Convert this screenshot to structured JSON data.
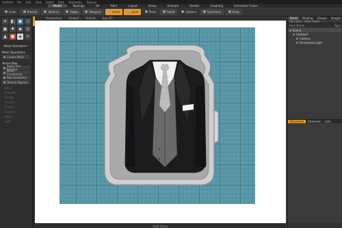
{
  "title_bar": {
    "app": "Untitled",
    "menus": [
      "File",
      "Edit",
      "View",
      "Select",
      "Item",
      "Geometry",
      "Texture"
    ]
  },
  "layout_tabs": [
    {
      "label": "Model",
      "active": true
    },
    {
      "label": "Topology",
      "active": false
    },
    {
      "label": "UV",
      "active": false
    },
    {
      "label": "Paint",
      "active": false
    },
    {
      "label": "Layout",
      "active": false
    },
    {
      "label": "Setup",
      "active": false
    },
    {
      "label": "Animate",
      "active": false
    },
    {
      "label": "Render",
      "active": false
    },
    {
      "label": "Graphing",
      "active": false
    },
    {
      "label": "Schematic Fusion",
      "active": false
    }
  ],
  "toolbar": {
    "buttons": [
      {
        "label": "Scale",
        "style": "plain"
      },
      {
        "label": "Presets",
        "style": "normal"
      },
      {
        "label": "Vertices",
        "style": "normal"
      },
      {
        "label": "Edges",
        "style": "normal"
      },
      {
        "label": "Polygons",
        "style": "normal"
      },
      {
        "label": "Items",
        "style": "orange"
      },
      {
        "label": "Local",
        "style": "orange"
      },
      {
        "label": "Pivot",
        "style": "plain"
      },
      {
        "label": "Falloff",
        "style": "normal"
      },
      {
        "label": "Options",
        "style": "plain"
      },
      {
        "label": "Symmetry",
        "style": "normal"
      },
      {
        "label": "Snap",
        "style": "normal"
      }
    ]
  },
  "left_panel": {
    "tool_icons": [
      {
        "glyph": "✦",
        "style": "normal"
      },
      {
        "glyph": "◧",
        "style": "normal"
      },
      {
        "glyph": "●",
        "style": "blue"
      },
      {
        "glyph": "❍",
        "style": "normal"
      },
      {
        "glyph": "▣",
        "style": "normal"
      },
      {
        "glyph": "✚",
        "style": "normal"
      },
      {
        "glyph": "◆",
        "style": "normal"
      },
      {
        "glyph": "⊙",
        "style": "normal"
      },
      {
        "glyph": "▲",
        "style": "normal"
      },
      {
        "glyph": "■",
        "style": "red"
      },
      {
        "glyph": "◈",
        "style": "lite"
      },
      {
        "glyph": "✧",
        "style": "normal"
      }
    ],
    "field": "Move Transform",
    "sections": [
      {
        "head": "Mesh Operations",
        "items": [
          {
            "label": "Create Mesh",
            "green": false
          }
        ]
      },
      {
        "head": "Vertex Map",
        "items": [
          {
            "label": "Apply and Preview",
            "green": true
          },
          {
            "label": "Mesh Constraints",
            "green": false
          },
          {
            "label": "Add Geometry",
            "green": false
          },
          {
            "label": "Texture Replica",
            "green": false
          }
        ]
      }
    ],
    "dim_items": [
      "Bevel",
      "Extrude",
      "Bridge",
      "Thicken",
      "Sculpt",
      "Smooth",
      "Weld",
      "Split"
    ]
  },
  "viewport": {
    "header_items": [
      "Perspective",
      "Shaded",
      "Default",
      "Eye (G)"
    ],
    "footer": "Auto Focus",
    "grid_color": "#5b9aaa",
    "grid_line_color": "#3d7587"
  },
  "right_panel": {
    "tabs": [
      {
        "label": "Items",
        "active": true
      },
      {
        "label": "Shading",
        "active": false
      },
      {
        "label": "Groups",
        "active": false
      },
      {
        "label": "Images",
        "active": false
      }
    ],
    "sub": [
      "Add Item",
      "Filter Items"
    ],
    "columns": [
      "Item Name",
      "Type"
    ],
    "tree": [
      {
        "label": "Scene",
        "indent": 0,
        "selected": true
      },
      {
        "label": "Untitled*",
        "indent": 1,
        "selected": false
      },
      {
        "label": "Camera",
        "indent": 2,
        "selected": false
      },
      {
        "label": "Directional Light",
        "indent": 2,
        "selected": false
      }
    ],
    "props_tabs": [
      {
        "label": "Properties",
        "active": true
      },
      {
        "label": "Channels",
        "active": false
      },
      {
        "label": "Lists",
        "active": false
      }
    ]
  }
}
